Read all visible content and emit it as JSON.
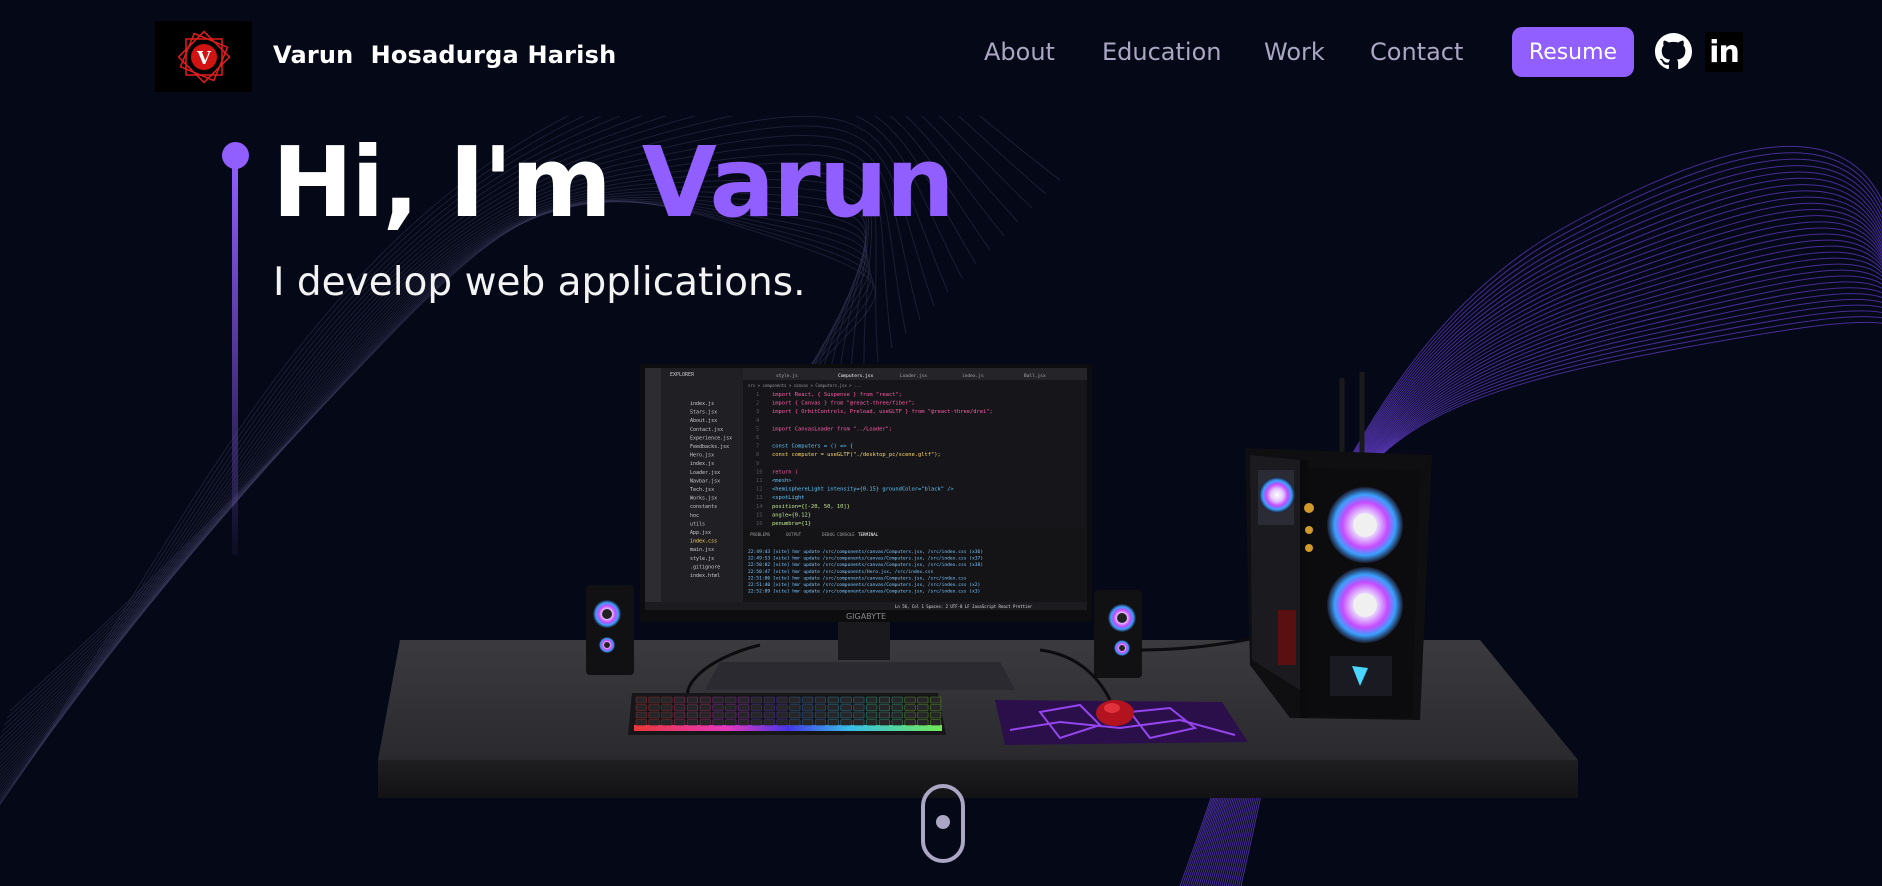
{
  "navbar": {
    "logo_letter": "V",
    "site_name": "Varun  Hosadurga Harish",
    "links": [
      {
        "label": "About"
      },
      {
        "label": "Education"
      },
      {
        "label": "Work"
      },
      {
        "label": "Contact"
      }
    ],
    "resume_label": "Resume",
    "icons": [
      "github-icon",
      "linkedin-icon"
    ],
    "linkedin_text": "in"
  },
  "hero": {
    "title_prefix": "Hi, I'm ",
    "title_name": "Varun",
    "subtitle": "I develop web applications."
  },
  "scene": {
    "monitor_brand": "GIGABYTE",
    "editor": {
      "sidebar_title": "EXPLORER",
      "tabs": [
        "style.js",
        "Computers.jsx",
        "Loader.jsx",
        "index.js",
        "Ball.jsx"
      ],
      "breadcrumb": "src > components > canvas > Computers.jsx > ...",
      "code_lines": [
        "import React, { Suspense } from \"react\";",
        "import { Canvas } from \"@react-three/fiber\";",
        "import { OrbitControls, Preload, useGLTF } from \"@react-three/drei\";",
        "",
        "import CanvasLoader from \"../Loader\";",
        "",
        "const Computers = () => {",
        "  const computer = useGLTF(\"./desktop_pc/scene.gltf\");",
        "",
        "  return (",
        "    <mesh>",
        "      <hemisphereLight intensity={0.15} groundColor=\"black\" />",
        "      <spotLight",
        "        position={[-20, 50, 10]}",
        "        angle={0.12}",
        "        penumbra={1}"
      ],
      "panel_tabs": [
        "PROBLEMS",
        "OUTPUT",
        "DEBUG CONSOLE",
        "TERMINAL"
      ],
      "terminal_lines": [
        "22:49:43 [vite] hmr update /src/components/canvas/Computers.jsx, /src/index.css (x36)",
        "22:49:53 [vite] hmr update /src/components/canvas/Computers.jsx, /src/index.css (x37)",
        "22:50:02 [vite] hmr update /src/components/canvas/Computers.jsx, /src/index.css (x38)",
        "22:50:47 [vite] hmr update /src/components/Hero.jsx, /src/index.css",
        "22:51:06 [vite] hmr update /src/components/canvas/Computers.jsx, /src/index.css",
        "22:51:40 [vite] hmr update /src/components/canvas/Computers.jsx, /src/index.css (x2)",
        "22:52:09 [vite] hmr update /src/components/canvas/Computers.jsx, /src/index.css (x3)"
      ],
      "files": [
        "index.js",
        "Stars.jsx",
        "About.jsx",
        "Contact.jsx",
        "Experience.jsx",
        "Feedbacks.jsx",
        "Hero.jsx",
        "index.js",
        "Loader.jsx",
        "Navbar.jsx",
        "Tech.jsx",
        "Works.jsx",
        "constants",
        "hoc",
        "utils",
        "App.jsx",
        "index.css",
        "main.jsx",
        "style.js",
        ".gitignore",
        "index.html"
      ],
      "status_right": "Ln 56, Col 1   Spaces: 2   UTF-8   LF   JavaScript React   Prettier"
    }
  },
  "colors": {
    "background": "#050816",
    "accent": "#915eff",
    "nav_text": "#aaa6c3"
  }
}
